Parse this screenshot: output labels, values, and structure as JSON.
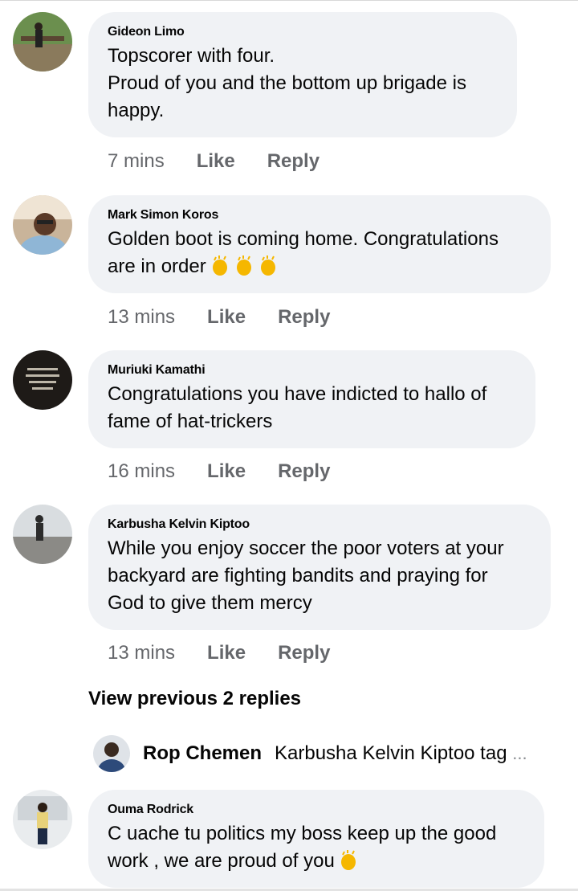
{
  "comments": [
    {
      "author": "Gideon Limo",
      "text": "Topscorer with four.\nProud of you and the bottom up brigade is\nhappy.",
      "time": "7 mins",
      "like": "Like",
      "reply": "Reply"
    },
    {
      "author": "Mark Simon Koros",
      "text": "Golden boot is coming home. Congratulations\nare in order",
      "emojis": "clapping-hands x3",
      "time": "13 mins",
      "like": "Like",
      "reply": "Reply"
    },
    {
      "author": "Muriuki Kamathi",
      "text": "Congratulations you have indicted to hallo of\nfame of hat-trickers",
      "time": "16 mins",
      "like": "Like",
      "reply": "Reply"
    },
    {
      "author": "Karbusha Kelvin Kiptoo",
      "text": "While you enjoy soccer the poor voters at your\nbackyard are fighting bandits and praying for\nGod to give them mercy",
      "time": "13 mins",
      "like": "Like",
      "reply": "Reply"
    },
    {
      "author": "Ouma Rodrick",
      "text": "C uache tu politics my boss keep up the good\nwork  , we are proud of you",
      "emojis": "clapping-hands x1"
    }
  ],
  "view_previous": "View previous 2 replies",
  "reply_preview": {
    "author": "Rop Chemen",
    "snippet": "Karbusha Kelvin Kiptoo tag",
    "ellipsis": "..."
  },
  "colors": {
    "bubble": "#f0f2f5",
    "meta": "#65676b",
    "text": "#050505"
  }
}
